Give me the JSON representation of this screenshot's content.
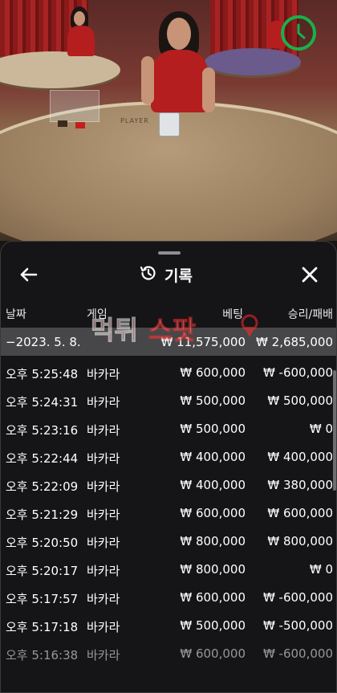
{
  "history": {
    "title": "기록",
    "title_icon": "history-icon",
    "back_icon": "arrow-left-icon",
    "close_icon": "close-icon",
    "columns": {
      "date": "날짜",
      "game": "게임",
      "bet": "베팅",
      "win_loss": "승리/패배"
    },
    "summary": {
      "date": "−2023. 5. 8.",
      "bet": "₩ 11,575,000",
      "win_loss": "₩ 2,685,000"
    },
    "rows": [
      {
        "time": "오후 5:25:48",
        "game": "바카라",
        "bet": "₩ 600,000",
        "win_loss": "₩ -600,000"
      },
      {
        "time": "오후 5:24:31",
        "game": "바카라",
        "bet": "₩ 500,000",
        "win_loss": "₩ 500,000"
      },
      {
        "time": "오후 5:23:16",
        "game": "바카라",
        "bet": "₩ 500,000",
        "win_loss": "₩ 0"
      },
      {
        "time": "오후 5:22:44",
        "game": "바카라",
        "bet": "₩ 400,000",
        "win_loss": "₩ 400,000"
      },
      {
        "time": "오후 5:22:09",
        "game": "바카라",
        "bet": "₩ 400,000",
        "win_loss": "₩ 380,000"
      },
      {
        "time": "오후 5:21:29",
        "game": "바카라",
        "bet": "₩ 600,000",
        "win_loss": "₩ 600,000"
      },
      {
        "time": "오후 5:20:50",
        "game": "바카라",
        "bet": "₩ 800,000",
        "win_loss": "₩ 800,000"
      },
      {
        "time": "오후 5:20:17",
        "game": "바카라",
        "bet": "₩ 800,000",
        "win_loss": "₩ 0"
      },
      {
        "time": "오후 5:17:57",
        "game": "바카라",
        "bet": "₩ 600,000",
        "win_loss": "₩ -600,000"
      },
      {
        "time": "오후 5:17:18",
        "game": "바카라",
        "bet": "₩ 500,000",
        "win_loss": "₩ -500,000"
      },
      {
        "time": "오후 5:16:38",
        "game": "바카라",
        "bet": "₩ 600,000",
        "win_loss": "₩ -600,000"
      }
    ]
  },
  "video": {
    "table_print": "PLAYER",
    "timer_icon": "clock-icon",
    "timer_color": "#18b14a"
  },
  "watermark": {
    "text": "먹튀스팟",
    "colors": [
      "#ff2a2a",
      "#ffffff"
    ]
  }
}
